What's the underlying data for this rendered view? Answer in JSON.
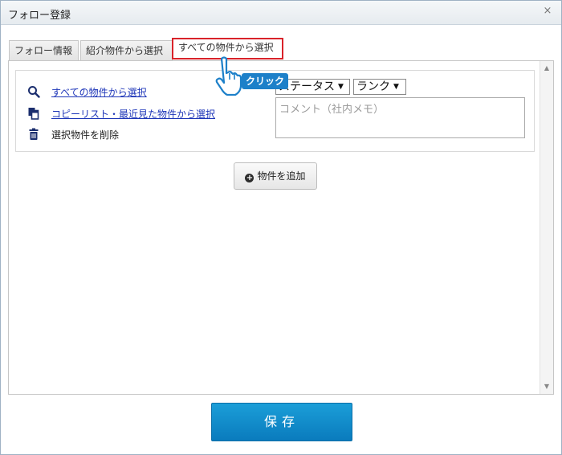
{
  "window": {
    "title": "フォロー登録",
    "close_glyph": "×"
  },
  "tabs": [
    {
      "label": "フォロー情報",
      "active": false
    },
    {
      "label": "紹介物件から選択",
      "active": false
    },
    {
      "label": "すべての物件から選択",
      "active": true
    }
  ],
  "actions": {
    "search_all": "すべての物件から選択",
    "copy_list": "コピーリスト・最近見た物件から選択",
    "delete_selected": "選択物件を削除"
  },
  "selects": {
    "status": "ステータス",
    "rank": "ランク"
  },
  "comment": {
    "placeholder": "コメント（社内メモ）"
  },
  "buttons": {
    "add_property": "物件を追加",
    "save": "保存"
  },
  "annotation": {
    "click_label": "クリック"
  },
  "colors": {
    "link": "#1d35b8",
    "save_button": "#0a7bbd",
    "highlight_border": "#d9232a",
    "click_badge": "#1d80c9"
  }
}
